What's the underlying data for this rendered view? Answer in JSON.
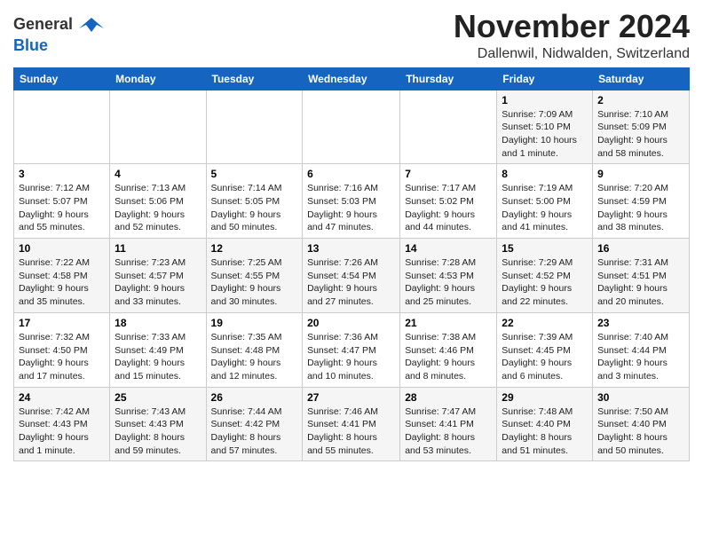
{
  "header": {
    "logo_general": "General",
    "logo_blue": "Blue",
    "title": "November 2024",
    "location": "Dallenwil, Nidwalden, Switzerland"
  },
  "weekdays": [
    "Sunday",
    "Monday",
    "Tuesday",
    "Wednesday",
    "Thursday",
    "Friday",
    "Saturday"
  ],
  "weeks": [
    [
      {
        "day": "",
        "sunrise": "",
        "sunset": "",
        "daylight": ""
      },
      {
        "day": "",
        "sunrise": "",
        "sunset": "",
        "daylight": ""
      },
      {
        "day": "",
        "sunrise": "",
        "sunset": "",
        "daylight": ""
      },
      {
        "day": "",
        "sunrise": "",
        "sunset": "",
        "daylight": ""
      },
      {
        "day": "",
        "sunrise": "",
        "sunset": "",
        "daylight": ""
      },
      {
        "day": "1",
        "sunrise": "Sunrise: 7:09 AM",
        "sunset": "Sunset: 5:10 PM",
        "daylight": "Daylight: 10 hours and 1 minute."
      },
      {
        "day": "2",
        "sunrise": "Sunrise: 7:10 AM",
        "sunset": "Sunset: 5:09 PM",
        "daylight": "Daylight: 9 hours and 58 minutes."
      }
    ],
    [
      {
        "day": "3",
        "sunrise": "Sunrise: 7:12 AM",
        "sunset": "Sunset: 5:07 PM",
        "daylight": "Daylight: 9 hours and 55 minutes."
      },
      {
        "day": "4",
        "sunrise": "Sunrise: 7:13 AM",
        "sunset": "Sunset: 5:06 PM",
        "daylight": "Daylight: 9 hours and 52 minutes."
      },
      {
        "day": "5",
        "sunrise": "Sunrise: 7:14 AM",
        "sunset": "Sunset: 5:05 PM",
        "daylight": "Daylight: 9 hours and 50 minutes."
      },
      {
        "day": "6",
        "sunrise": "Sunrise: 7:16 AM",
        "sunset": "Sunset: 5:03 PM",
        "daylight": "Daylight: 9 hours and 47 minutes."
      },
      {
        "day": "7",
        "sunrise": "Sunrise: 7:17 AM",
        "sunset": "Sunset: 5:02 PM",
        "daylight": "Daylight: 9 hours and 44 minutes."
      },
      {
        "day": "8",
        "sunrise": "Sunrise: 7:19 AM",
        "sunset": "Sunset: 5:00 PM",
        "daylight": "Daylight: 9 hours and 41 minutes."
      },
      {
        "day": "9",
        "sunrise": "Sunrise: 7:20 AM",
        "sunset": "Sunset: 4:59 PM",
        "daylight": "Daylight: 9 hours and 38 minutes."
      }
    ],
    [
      {
        "day": "10",
        "sunrise": "Sunrise: 7:22 AM",
        "sunset": "Sunset: 4:58 PM",
        "daylight": "Daylight: 9 hours and 35 minutes."
      },
      {
        "day": "11",
        "sunrise": "Sunrise: 7:23 AM",
        "sunset": "Sunset: 4:57 PM",
        "daylight": "Daylight: 9 hours and 33 minutes."
      },
      {
        "day": "12",
        "sunrise": "Sunrise: 7:25 AM",
        "sunset": "Sunset: 4:55 PM",
        "daylight": "Daylight: 9 hours and 30 minutes."
      },
      {
        "day": "13",
        "sunrise": "Sunrise: 7:26 AM",
        "sunset": "Sunset: 4:54 PM",
        "daylight": "Daylight: 9 hours and 27 minutes."
      },
      {
        "day": "14",
        "sunrise": "Sunrise: 7:28 AM",
        "sunset": "Sunset: 4:53 PM",
        "daylight": "Daylight: 9 hours and 25 minutes."
      },
      {
        "day": "15",
        "sunrise": "Sunrise: 7:29 AM",
        "sunset": "Sunset: 4:52 PM",
        "daylight": "Daylight: 9 hours and 22 minutes."
      },
      {
        "day": "16",
        "sunrise": "Sunrise: 7:31 AM",
        "sunset": "Sunset: 4:51 PM",
        "daylight": "Daylight: 9 hours and 20 minutes."
      }
    ],
    [
      {
        "day": "17",
        "sunrise": "Sunrise: 7:32 AM",
        "sunset": "Sunset: 4:50 PM",
        "daylight": "Daylight: 9 hours and 17 minutes."
      },
      {
        "day": "18",
        "sunrise": "Sunrise: 7:33 AM",
        "sunset": "Sunset: 4:49 PM",
        "daylight": "Daylight: 9 hours and 15 minutes."
      },
      {
        "day": "19",
        "sunrise": "Sunrise: 7:35 AM",
        "sunset": "Sunset: 4:48 PM",
        "daylight": "Daylight: 9 hours and 12 minutes."
      },
      {
        "day": "20",
        "sunrise": "Sunrise: 7:36 AM",
        "sunset": "Sunset: 4:47 PM",
        "daylight": "Daylight: 9 hours and 10 minutes."
      },
      {
        "day": "21",
        "sunrise": "Sunrise: 7:38 AM",
        "sunset": "Sunset: 4:46 PM",
        "daylight": "Daylight: 9 hours and 8 minutes."
      },
      {
        "day": "22",
        "sunrise": "Sunrise: 7:39 AM",
        "sunset": "Sunset: 4:45 PM",
        "daylight": "Daylight: 9 hours and 6 minutes."
      },
      {
        "day": "23",
        "sunrise": "Sunrise: 7:40 AM",
        "sunset": "Sunset: 4:44 PM",
        "daylight": "Daylight: 9 hours and 3 minutes."
      }
    ],
    [
      {
        "day": "24",
        "sunrise": "Sunrise: 7:42 AM",
        "sunset": "Sunset: 4:43 PM",
        "daylight": "Daylight: 9 hours and 1 minute."
      },
      {
        "day": "25",
        "sunrise": "Sunrise: 7:43 AM",
        "sunset": "Sunset: 4:43 PM",
        "daylight": "Daylight: 8 hours and 59 minutes."
      },
      {
        "day": "26",
        "sunrise": "Sunrise: 7:44 AM",
        "sunset": "Sunset: 4:42 PM",
        "daylight": "Daylight: 8 hours and 57 minutes."
      },
      {
        "day": "27",
        "sunrise": "Sunrise: 7:46 AM",
        "sunset": "Sunset: 4:41 PM",
        "daylight": "Daylight: 8 hours and 55 minutes."
      },
      {
        "day": "28",
        "sunrise": "Sunrise: 7:47 AM",
        "sunset": "Sunset: 4:41 PM",
        "daylight": "Daylight: 8 hours and 53 minutes."
      },
      {
        "day": "29",
        "sunrise": "Sunrise: 7:48 AM",
        "sunset": "Sunset: 4:40 PM",
        "daylight": "Daylight: 8 hours and 51 minutes."
      },
      {
        "day": "30",
        "sunrise": "Sunrise: 7:50 AM",
        "sunset": "Sunset: 4:40 PM",
        "daylight": "Daylight: 8 hours and 50 minutes."
      }
    ]
  ]
}
